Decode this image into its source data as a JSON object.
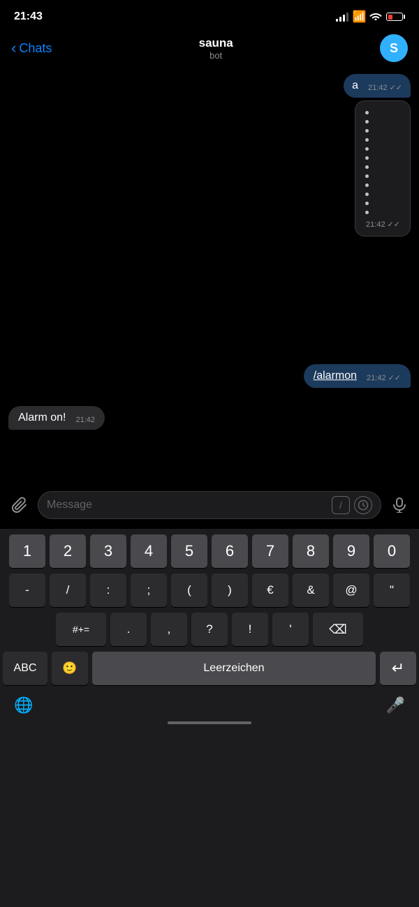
{
  "statusBar": {
    "time": "21:43",
    "battery_low": true
  },
  "navBar": {
    "back_label": "Chats",
    "title": "sauna",
    "subtitle": "bot",
    "avatar_letter": "S"
  },
  "messages": [
    {
      "id": "msg1",
      "type": "sent",
      "text": "a",
      "time": "21:42"
    },
    {
      "id": "msg2",
      "type": "sent_dots",
      "dots": 12,
      "time": "21:42"
    },
    {
      "id": "msg3",
      "type": "sent",
      "text": "/alarmon",
      "time": "21:42"
    },
    {
      "id": "msg4",
      "type": "received",
      "text": "Alarm on!",
      "time": "21:42"
    }
  ],
  "inputBar": {
    "placeholder": "Message",
    "value": ""
  },
  "keyboard": {
    "row1": [
      "1",
      "2",
      "3",
      "4",
      "5",
      "6",
      "7",
      "8",
      "9",
      "0"
    ],
    "row2": [
      "-",
      "/",
      ":",
      ";",
      " ( ",
      " ) ",
      "€",
      "&",
      "@",
      "\""
    ],
    "row3": [
      "#+=",
      ".",
      ",",
      "?",
      "!",
      "'",
      "⌫"
    ],
    "row4_left": "ABC",
    "row4_emoji": "🙂",
    "row4_space": "Leerzeichen",
    "row4_return": "↵",
    "bottom_globe": "🌐",
    "bottom_mic": "🎤"
  }
}
